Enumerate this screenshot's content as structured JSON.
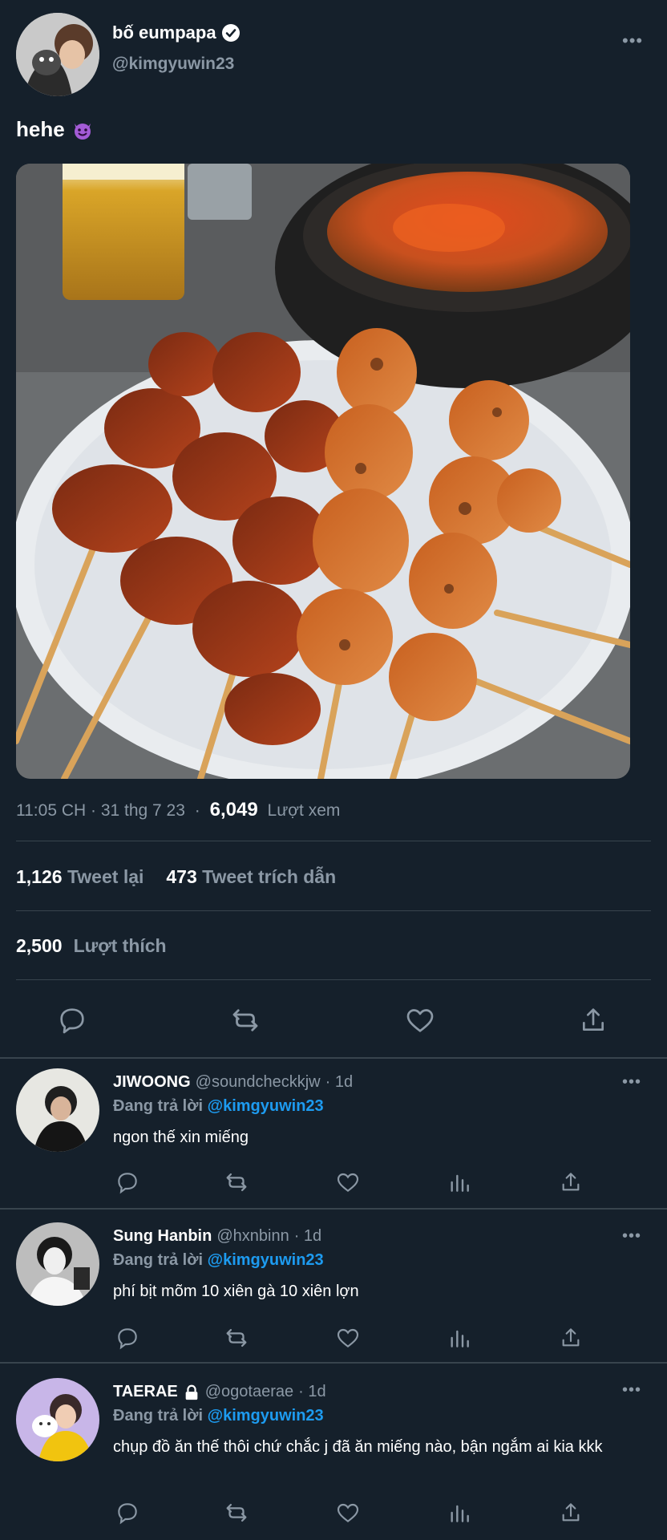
{
  "tweet": {
    "author": {
      "display_name": "bố eumpapa",
      "handle": "@kimgyuwin23",
      "verified": true
    },
    "text": "hehe",
    "emoji_icon": "smiling-devil-icon",
    "time": "11:05 CH · 31 thg 7 23",
    "dot": "·",
    "views": "6,049",
    "views_label": "Lượt xem",
    "retweets": "1,126",
    "retweets_label": "Tweet lại",
    "quotes": "473",
    "quotes_label": "Tweet trích dẫn",
    "likes": "2,500",
    "likes_label": "Lượt thích"
  },
  "colors": {
    "background": "#15202b",
    "muted": "#8b98a5",
    "accent": "#1d9bf0",
    "divider": "#38444d"
  },
  "replies": [
    {
      "name": "JIWOONG",
      "handle": "@soundcheckkjw",
      "time": "· 1d",
      "replying_label": "Đang trả lời",
      "replying_to": "@kimgyuwin23",
      "text": "ngon thế xin miếng"
    },
    {
      "name": "Sung Hanbin",
      "handle": "@hxnbinn",
      "time": "· 1d",
      "replying_label": "Đang trả lời",
      "replying_to": "@kimgyuwin23",
      "text": "phí bịt mõm 10 xiên gà 10 xiên lợn"
    },
    {
      "name": "TAERAE",
      "handle": "@ogotaerae",
      "time": "· 1d",
      "locked": true,
      "replying_label": "Đang trả lời",
      "replying_to": "@kimgyuwin23",
      "text": "chụp đồ ăn thế thôi chứ chắc j đã ăn miếng nào, bận ngắm ai kia kkk"
    }
  ],
  "more_glyph": "•••"
}
